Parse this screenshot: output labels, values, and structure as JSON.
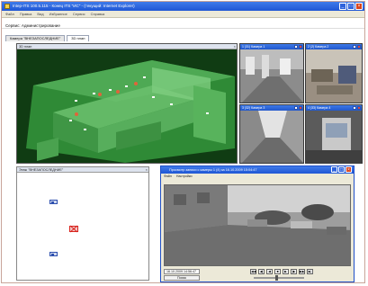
{
  "window": {
    "title": "Intep-ITS 100.5.115 - Конец ITS \"ИС\" - (текущий: Internet Explorer)"
  },
  "menu": [
    "Файл",
    "Правка",
    "Вид",
    "Избранное",
    "Сервис",
    "Справка"
  ],
  "statusline": {
    "text": "Сервис: Администрирование"
  },
  "tabs": [
    {
      "label": "Камера \"ВНЕЗАПОСЛЕДНИЕ\""
    },
    {
      "label": "3D план"
    }
  ],
  "view3d": {
    "title": "3D план"
  },
  "cameras": [
    {
      "title": "1 (31) Камера 1"
    },
    {
      "title": "2 (2) Камера 2"
    },
    {
      "title": "3 (32) Камера 3"
    },
    {
      "title": "4 (33) Камера 4"
    }
  ],
  "map": {
    "title": "Этаж \"ВНЕЗАПОСЛЕДНИЕ\""
  },
  "player": {
    "title": "Просмотр записи с камеры 1 (4) за 16.10.2009 15:04:47",
    "menu": [
      "Файл",
      "Настройки"
    ],
    "timestamp": "16.10.2009 14:56:47",
    "search_label": "Поиск",
    "seek_fraction": 0.45
  },
  "colors": {
    "titlebar": "#1f56d4",
    "view3d_bg": "#0f3d12",
    "alarm": "#d8231c"
  }
}
